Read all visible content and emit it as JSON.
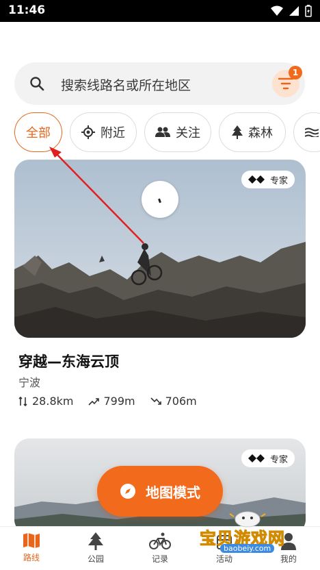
{
  "status": {
    "time": "11:46"
  },
  "search": {
    "placeholder": "搜索线路名或所在地区",
    "filter_badge": "1"
  },
  "chips": [
    {
      "label": "全部",
      "active": true
    },
    {
      "label": "附近",
      "icon": "locate-icon"
    },
    {
      "label": "关注",
      "icon": "people-icon"
    },
    {
      "label": "森林",
      "icon": "tree-icon"
    },
    {
      "label": "",
      "icon": "wave-icon"
    }
  ],
  "cards": [
    {
      "tag": "专家",
      "title": "穿越—东海云顶",
      "region": "宁波",
      "distance": "28.8km",
      "ascent": "799m",
      "descent": "706m"
    },
    {
      "tag": "专家"
    }
  ],
  "map_mode_button": "地图模式",
  "nav": [
    {
      "label": "路线",
      "icon": "map-icon",
      "active": true
    },
    {
      "label": "公园",
      "icon": "tree-icon"
    },
    {
      "label": "记录",
      "icon": "bike-icon"
    },
    {
      "label": "活动",
      "icon": "calendar-icon"
    },
    {
      "label": "我的",
      "icon": "user-icon"
    }
  ],
  "watermark": {
    "text": "宝贝游戏网",
    "url": "baobeiy.com"
  },
  "colors": {
    "accent": "#f26b1d",
    "accent_light": "#fde2cf"
  }
}
